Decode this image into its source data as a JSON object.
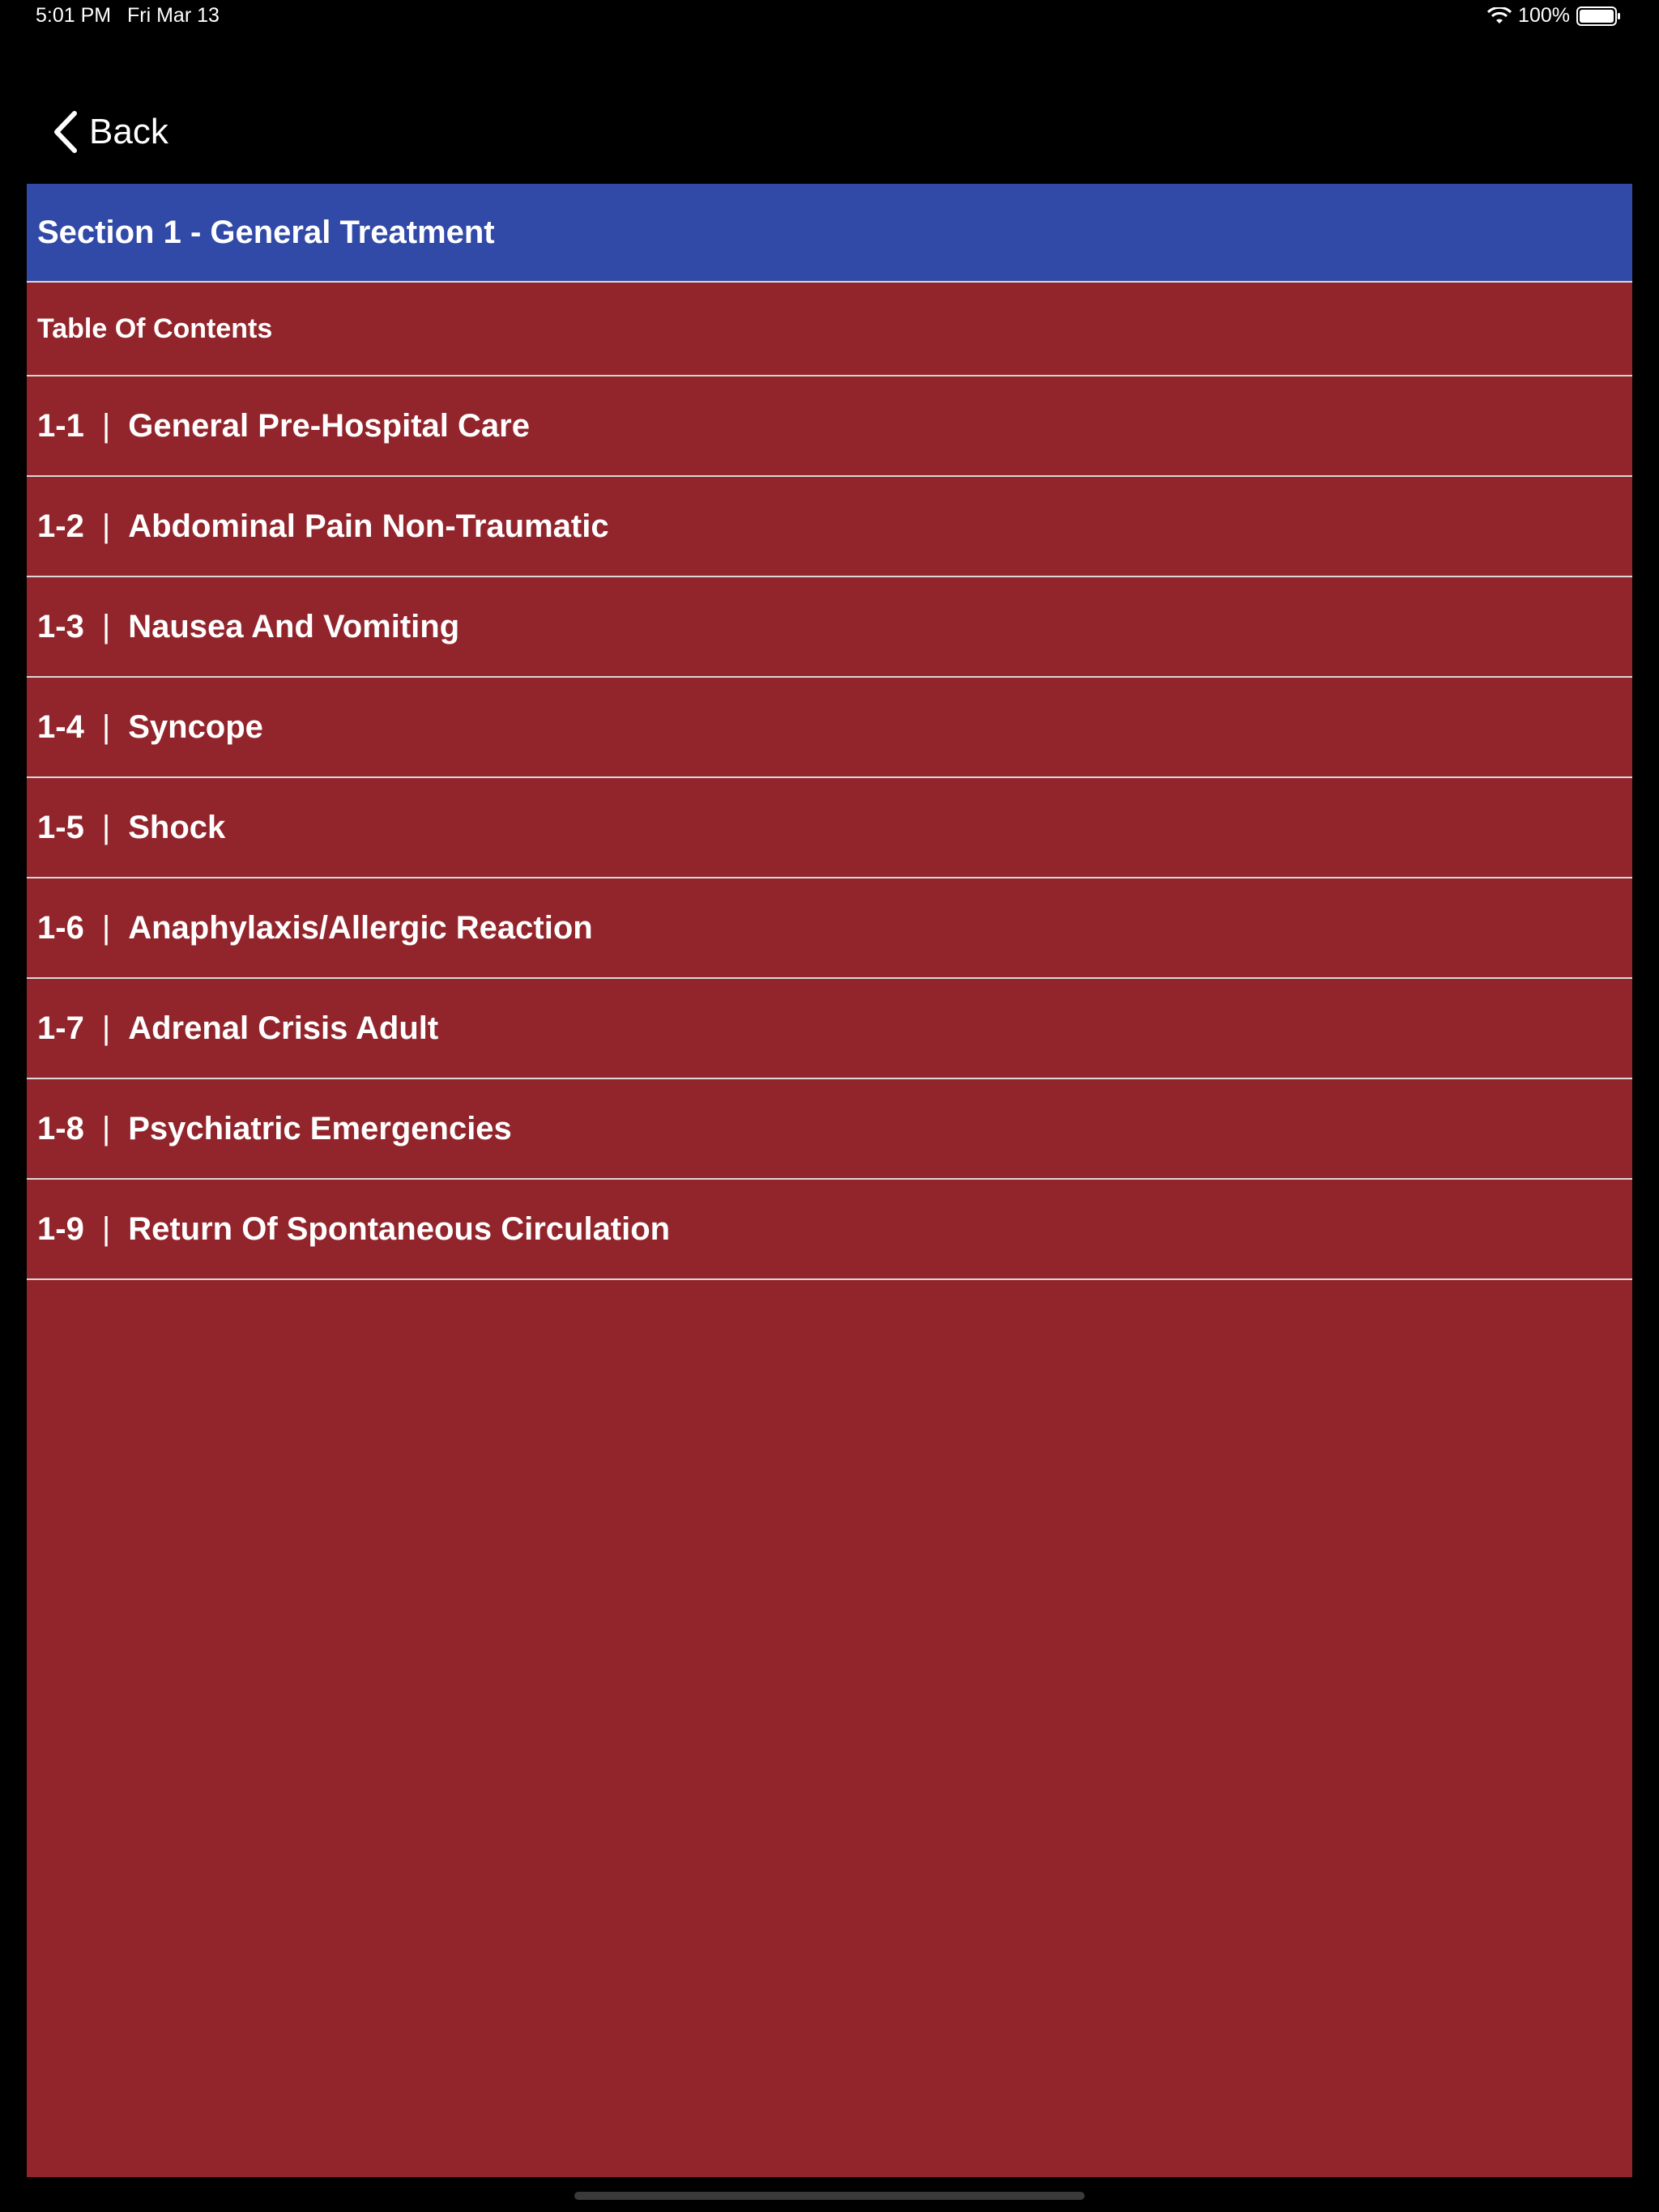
{
  "status_bar": {
    "time": "5:01 PM",
    "date": "Fri Mar 13",
    "battery": "100%"
  },
  "nav": {
    "back_label": "Back"
  },
  "section": {
    "title": "Section 1 - General Treatment",
    "toc_label": "Table Of Contents",
    "separator": "|",
    "items": [
      {
        "number": "1-1",
        "title": "General Pre-Hospital Care"
      },
      {
        "number": "1-2",
        "title": "Abdominal Pain Non-Traumatic"
      },
      {
        "number": "1-3",
        "title": "Nausea And Vomiting"
      },
      {
        "number": "1-4",
        "title": "Syncope"
      },
      {
        "number": "1-5",
        "title": "Shock"
      },
      {
        "number": "1-6",
        "title": "Anaphylaxis/Allergic Reaction"
      },
      {
        "number": "1-7",
        "title": "Adrenal Crisis Adult"
      },
      {
        "number": "1-8",
        "title": "Psychiatric Emergencies"
      },
      {
        "number": "1-9",
        "title": "Return Of Spontaneous Circulation"
      }
    ]
  },
  "colors": {
    "header_blue": "#324aa7",
    "panel_red": "#92252b",
    "divider": "#d9d9d9"
  },
  "icons": {
    "wifi": "wifi-icon",
    "battery": "battery-icon",
    "back": "chevron-left-icon"
  }
}
